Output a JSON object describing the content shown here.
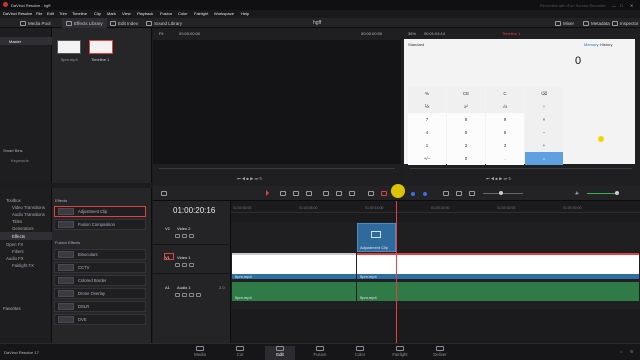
{
  "window": {
    "app_title": "DaVinci Resolve - hgff",
    "watermark": "Recorded with iFun Screen Recorder"
  },
  "menu": [
    "DaVinci Resolve",
    "File",
    "Edit",
    "Trim",
    "Timeline",
    "Clip",
    "Mark",
    "View",
    "Playback",
    "Fusion",
    "Color",
    "Fairlight",
    "Workspace",
    "Help"
  ],
  "toolbar": {
    "media_pool": "Media Pool",
    "effects_library": "Effects Library",
    "edit_index": "Edit Index",
    "sound_library": "Sound Library",
    "project_name": "hgff",
    "mixer": "Mixer",
    "metadata": "Metadata",
    "inspector": "Inspector"
  },
  "bins": {
    "master": "Master",
    "smart_bins": "Smart Bins",
    "keywords": "Keywords"
  },
  "media_pool": {
    "clips": [
      {
        "name": "5pm.mp4"
      },
      {
        "name": "Timeline 1"
      }
    ]
  },
  "source_viewer": {
    "zoom": "Fit",
    "timecode_left": "00:00:00:00",
    "timecode_right": "00:00:00:00"
  },
  "timeline_viewer": {
    "zoom": "36%",
    "timecode": "00:01:04:14",
    "timeline_name": "Timeline 1",
    "calc_mode": "Standard",
    "calc_display": "0",
    "calc_tabs": [
      "Memory",
      "History"
    ],
    "calc_keys": [
      "%",
      "CE",
      "C",
      "⌫",
      "⅟x",
      "x²",
      "√x",
      "÷",
      "7",
      "8",
      "9",
      "×",
      "4",
      "5",
      "6",
      "−",
      "1",
      "2",
      "3",
      "+",
      "+/−",
      "0",
      ".",
      "="
    ]
  },
  "effects_tree": {
    "items": [
      "Toolbox",
      "Video Transitions",
      "Audio Transitions",
      "Titles",
      "Generators",
      "Effects",
      "Open FX",
      "Filters",
      "Audio FX",
      "Fairlight FX"
    ],
    "favorites": "Favorites"
  },
  "effects_list": {
    "section1": "Effects",
    "items1": [
      "Adjustment Clip",
      "Fusion Composition"
    ],
    "section2": "Fusion Effects",
    "items2": [
      "Binoculars",
      "CCTV",
      "Colored Border",
      "Drone Overlay",
      "DSLR",
      "DVE"
    ]
  },
  "timeline": {
    "timecode": "01:00:20:16",
    "ruler": [
      "01:00:00:00",
      "01:00:08:00",
      "01:00:16:00",
      "01:00:24:00",
      "01:00:32:00",
      "01:00:40:00"
    ],
    "tracks": [
      {
        "id": "V2",
        "name": "Video 2"
      },
      {
        "id": "V1",
        "name": "Video 1"
      },
      {
        "id": "A1",
        "name": "Audio 1",
        "level": "2.0"
      }
    ],
    "adjustment_clip_label": "Adjustment Clip",
    "clip_label": "5pm.mp4"
  },
  "pages": [
    "Media",
    "Cut",
    "Edit",
    "Fusion",
    "Color",
    "Fairlight",
    "Deliver"
  ],
  "colors": {
    "accent": "#e0433f",
    "video_clip": "#2d6f9e",
    "audio_clip": "#2e7b48",
    "adjustment": "#2f6a9c",
    "cursor_highlight": "#f2d600"
  },
  "status": {
    "version": "DaVinci Resolve 17"
  }
}
